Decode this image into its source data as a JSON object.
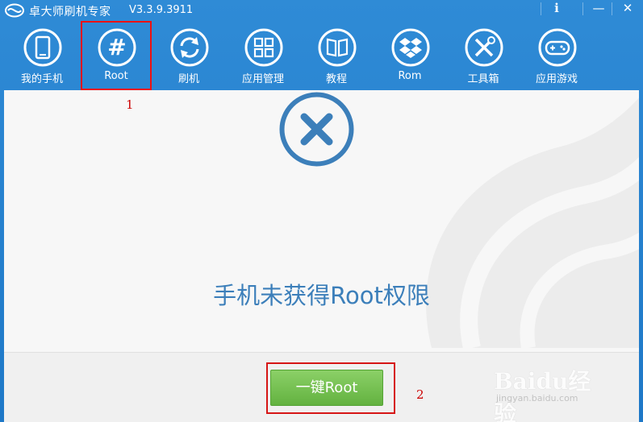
{
  "app": {
    "title": "卓大师刷机专家",
    "version": "V3.3.9.3911"
  },
  "window_controls": {
    "info": "i",
    "minimize": "—",
    "close": "✕"
  },
  "toolbar": [
    {
      "label": "我的手机",
      "icon": "phone-icon"
    },
    {
      "label": "Root",
      "icon": "hash-icon"
    },
    {
      "label": "刷机",
      "icon": "refresh-icon"
    },
    {
      "label": "应用管理",
      "icon": "grid-icon"
    },
    {
      "label": "教程",
      "icon": "book-icon"
    },
    {
      "label": "Rom",
      "icon": "dropbox-icon"
    },
    {
      "label": "工具箱",
      "icon": "tools-icon"
    },
    {
      "label": "应用游戏",
      "icon": "gamepad-icon"
    }
  ],
  "annotations": {
    "one": "1",
    "two": "2"
  },
  "main": {
    "status_message": "手机未获得Root权限",
    "status_icon": "error-x-icon",
    "root_button": "一键Root"
  },
  "watermark": {
    "brand": "Baidu经验",
    "url": "jingyan.baidu.com"
  },
  "colors": {
    "titlebar": "#2f8bd6",
    "status_text": "#3c7fba",
    "button_green": "#63b240",
    "annotation_red": "#e11111"
  }
}
